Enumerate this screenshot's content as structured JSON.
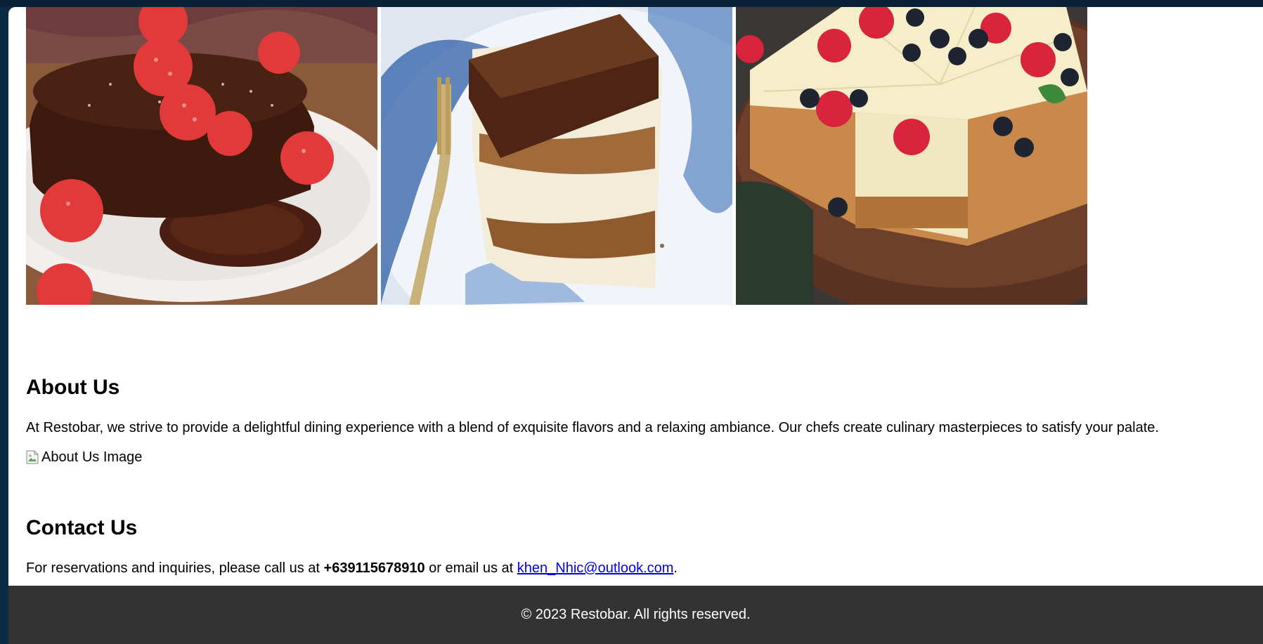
{
  "gallery": {
    "images": [
      {
        "name": "chocolate lava cake"
      },
      {
        "name": "tiramisu"
      },
      {
        "name": "cheesecake"
      }
    ]
  },
  "about": {
    "title": "About Us",
    "text": "At Restobar, we strive to provide a delightful dining experience with a blend of exquisite flavors and a relaxing ambiance. Our chefs create culinary masterpieces to satisfy your palate.",
    "image_alt": "About Us Image"
  },
  "contact": {
    "title": "Contact Us",
    "text_before": "For reservations and inquiries, please call us at ",
    "phone": "+639115678910",
    "text_middle": " or email us at ",
    "email": "khen_Nhic@outlook.com",
    "text_after": "."
  },
  "footer": {
    "text": "© 2023 Restobar. All rights reserved."
  },
  "colors": {
    "header_bg": "#0a2238",
    "footer_bg": "#333333",
    "link": "#0000ee"
  }
}
